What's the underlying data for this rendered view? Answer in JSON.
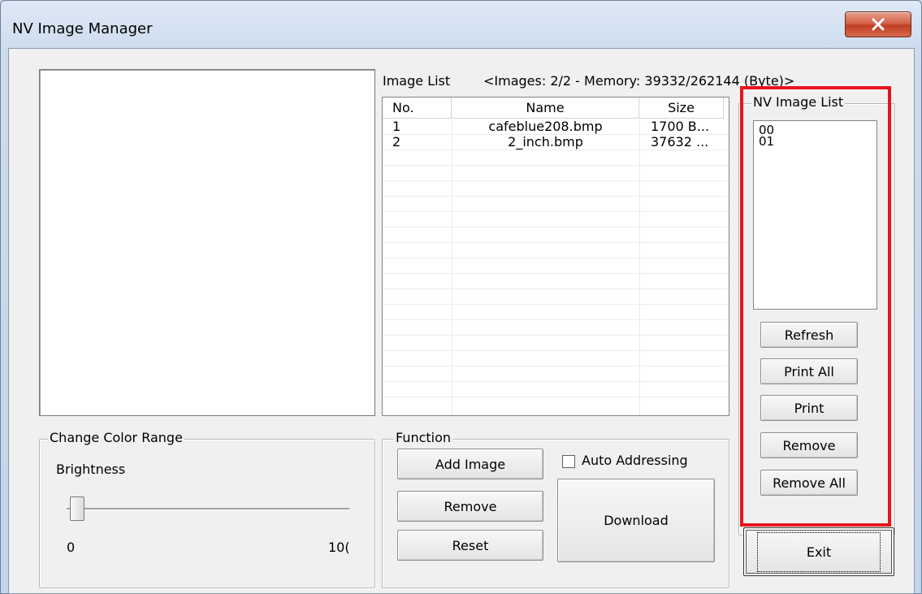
{
  "window": {
    "title": "NV Image Manager"
  },
  "image_list": {
    "label": "Image List",
    "info": "<Images: 2/2 - Memory: 39332/262144 (Byte)>",
    "columns": [
      "No.",
      "Name",
      "Size"
    ],
    "rows": [
      {
        "no": "1",
        "name": "cafeblue208.bmp",
        "size": "1700 B..."
      },
      {
        "no": "2",
        "name": "2_inch.bmp",
        "size": "37632 ..."
      }
    ]
  },
  "nv_image_list": {
    "label": "NV Image List",
    "items": [
      "00",
      "01"
    ],
    "buttons": {
      "refresh": "Refresh",
      "print_all": "Print All",
      "print": "Print",
      "remove": "Remove",
      "remove_all": "Remove All"
    }
  },
  "color_range": {
    "label": "Change Color Range",
    "brightness_label": "Brightness",
    "min": "0",
    "max": "10(",
    "brightness_value": 0
  },
  "function_group": {
    "label": "Function",
    "add_image": "Add Image",
    "auto_addressing": "Auto Addressing",
    "auto_addressing_checked": false,
    "remove": "Remove",
    "reset": "Reset",
    "download": "Download"
  },
  "exit_label": "Exit",
  "colors": {
    "highlight": "#e8141c",
    "close_button": "#c94d33"
  }
}
